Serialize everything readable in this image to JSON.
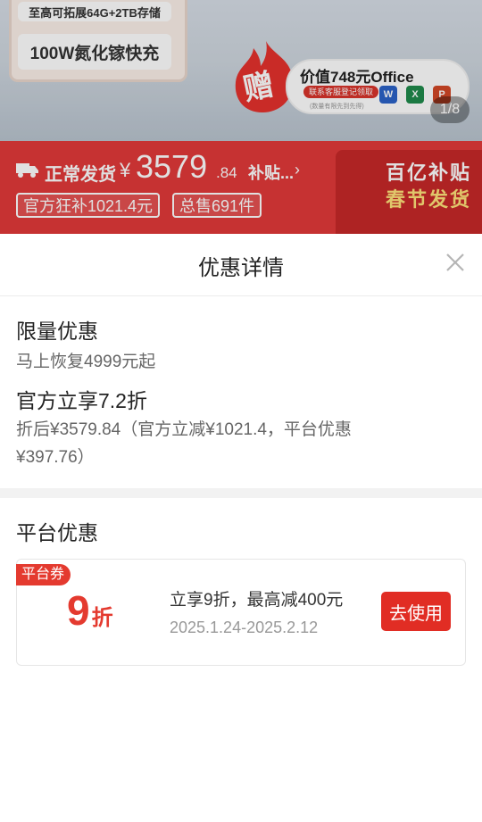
{
  "background": {
    "spec_card": {
      "line1": "至高可拓展64G+2TB存储",
      "line2": "100W氮化镓快充"
    },
    "gift": {
      "badge": "赠",
      "office_title": "价值748元Office",
      "office_sub": "联系客服登记领取",
      "office_note": "(数量有限先到先得)",
      "apps": [
        "W",
        "X",
        "P"
      ]
    },
    "page_indicator": "1/8",
    "promo": {
      "shipping_label": "正常发货",
      "currency": "¥",
      "price_int": "3579",
      "price_dec": ".84",
      "subsidy_link": "补贴...",
      "tags": [
        "官方狂补1021.4元",
        "总售691件"
      ],
      "event_line1": "百亿补贴",
      "event_line2": "春节发货"
    }
  },
  "sheet": {
    "title": "优惠详情",
    "items": [
      {
        "title": "限量优惠",
        "desc": "马上恢复4999元起"
      },
      {
        "title": "官方立享7.2折",
        "desc": "折后¥3579.84（官方立减¥1021.4，平台优惠¥397.76）"
      }
    ],
    "platform_title": "平台优惠",
    "coupon": {
      "badge": "平台券",
      "value": "9",
      "unit": "折",
      "desc": "立享9折，最高减400元",
      "date_range": "2025.1.24-2025.2.12",
      "button_label": "去使用"
    }
  },
  "colors": {
    "accent_red": "#e12d24",
    "promo_band": "#e23a3a"
  }
}
